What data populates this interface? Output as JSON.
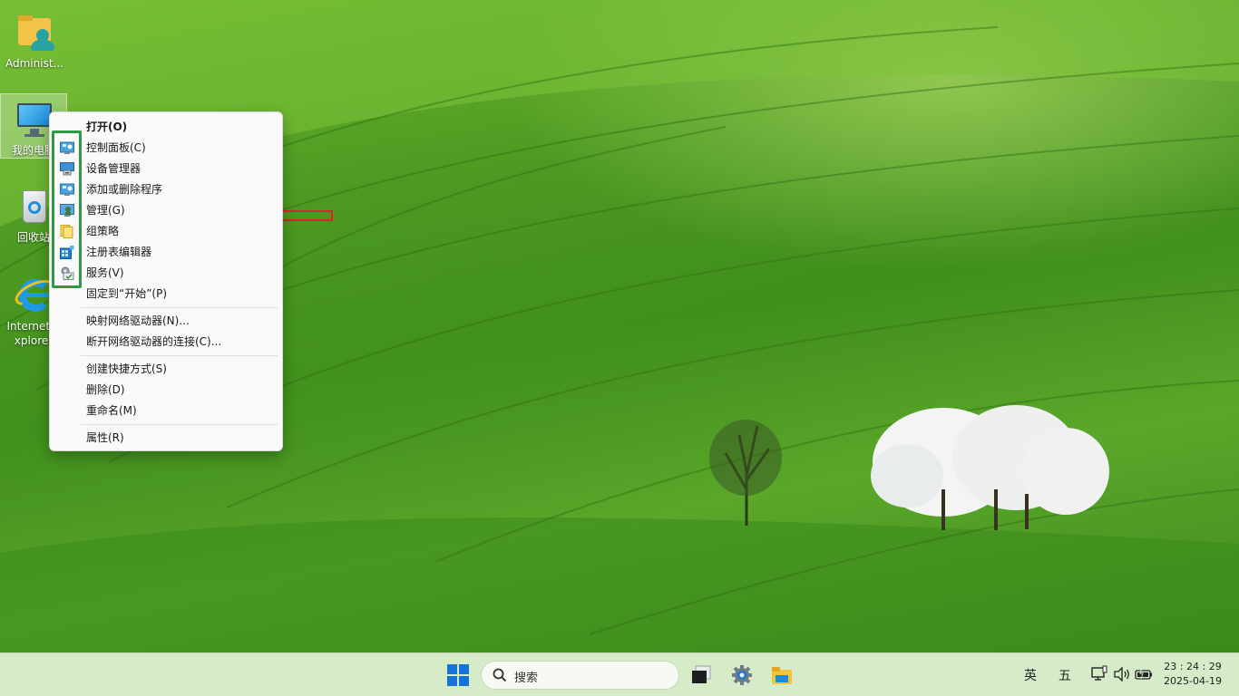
{
  "desktop": {
    "icons": [
      {
        "label": "Administ..."
      },
      {
        "label": "我的电脑"
      },
      {
        "label": "回收站"
      },
      {
        "label": "Internet Explorer"
      }
    ]
  },
  "context_menu": {
    "groups": [
      {
        "items": [
          {
            "label": "打开(O)",
            "icon": "none",
            "default": true
          },
          {
            "label": "控制面板(C)",
            "icon": "control-panel-icon"
          },
          {
            "label": "设备管理器",
            "icon": "device-manager-icon"
          },
          {
            "label": "添加或删除程序",
            "icon": "programs-icon"
          },
          {
            "label": "管理(G)",
            "icon": "computer-management-icon"
          },
          {
            "label": "组策略",
            "icon": "group-policy-icon"
          },
          {
            "label": "注册表编辑器",
            "icon": "registry-editor-icon"
          },
          {
            "label": "服务(V)",
            "icon": "services-icon"
          },
          {
            "label": "固定到“开始”(P)",
            "icon": "none"
          }
        ]
      },
      {
        "items": [
          {
            "label": "映射网络驱动器(N)...",
            "icon": "none"
          },
          {
            "label": "断开网络驱动器的连接(C)...",
            "icon": "none"
          }
        ]
      },
      {
        "items": [
          {
            "label": "创建快捷方式(S)",
            "icon": "none"
          },
          {
            "label": "删除(D)",
            "icon": "none"
          },
          {
            "label": "重命名(M)",
            "icon": "none"
          }
        ]
      },
      {
        "items": [
          {
            "label": "属性(R)",
            "icon": "none"
          }
        ]
      }
    ]
  },
  "annotation": {
    "arrow_color": "#d9262c",
    "box_color": "#2e9a46"
  },
  "taskbar": {
    "search_label": "搜索",
    "ime_lang": "英",
    "ime_mode": "五",
    "time": "23 : 24 : 29",
    "date": "2025-04-19"
  },
  "colors": {
    "accent": "#1473d6",
    "taskbar_bg": "#d6ecc9"
  }
}
